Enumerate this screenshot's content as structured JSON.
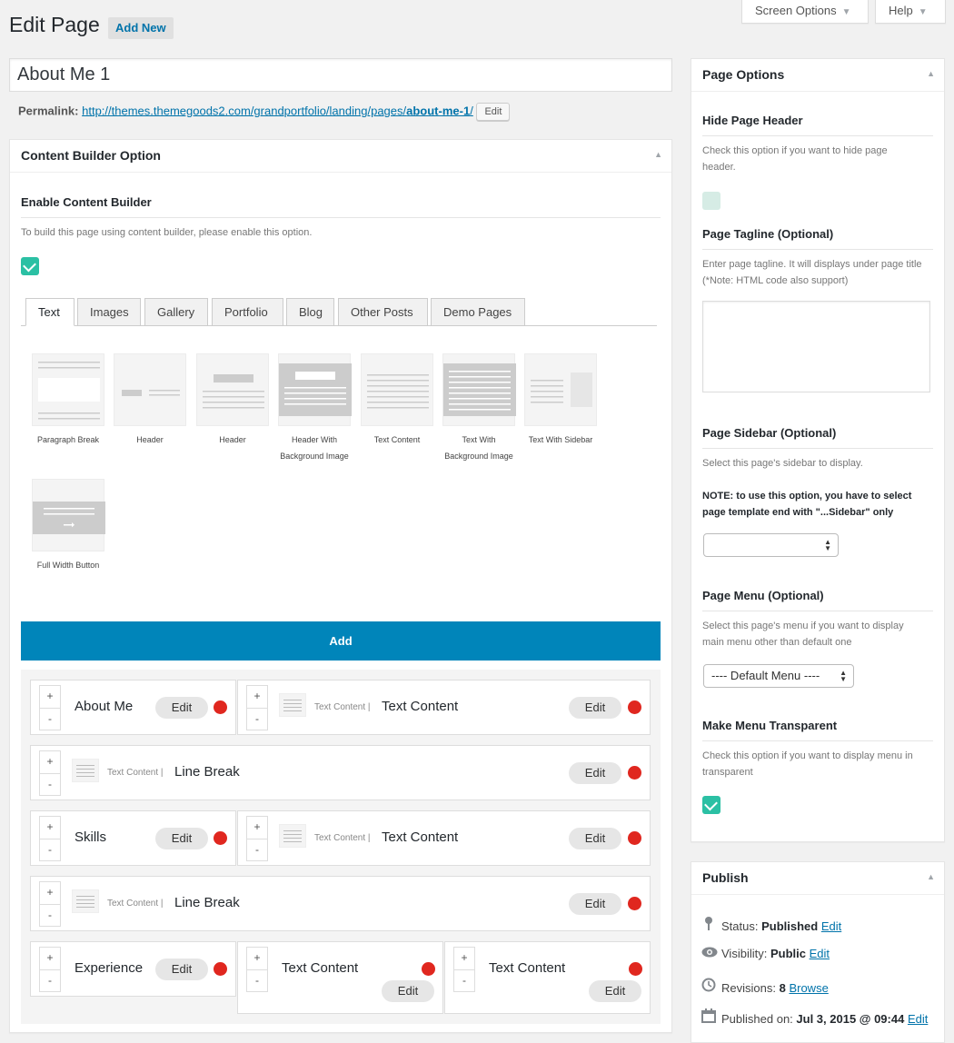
{
  "header": {
    "title": "Edit Page",
    "add_new": "Add New"
  },
  "screen_meta": {
    "screen_options": "Screen Options",
    "help": "Help"
  },
  "post": {
    "title": "About Me 1",
    "permalink_label": "Permalink:",
    "permalink_base": "http://themes.themegoods2.com/grandportfolio/landing/pages/",
    "permalink_slug": "about-me-1",
    "permalink_end": "/",
    "edit": "Edit"
  },
  "content_builder": {
    "box_title": "Content Builder Option",
    "enable_title": "Enable Content Builder",
    "enable_desc": "To build this page using content builder, please enable this option.",
    "tabs": [
      "Text",
      "Images",
      "Gallery",
      "Portfolio",
      "Blog",
      "Other Posts",
      "Demo Pages"
    ],
    "modules": [
      {
        "label1": "Paragraph Break",
        "label2": ""
      },
      {
        "label1": "Header",
        "label2": ""
      },
      {
        "label1": "Header",
        "label2": ""
      },
      {
        "label1": "Header With",
        "label2": "Background Image"
      },
      {
        "label1": "Text Content",
        "label2": ""
      },
      {
        "label1": "Text With",
        "label2": "Background Image"
      },
      {
        "label1": "Text With Sidebar",
        "label2": ""
      },
      {
        "label1": "Full Width Button",
        "label2": ""
      }
    ],
    "add_label": "Add",
    "edit_label": "Edit",
    "type_text": "Text Content |",
    "blocks": {
      "about_me": "About Me",
      "text_content": "Text Content",
      "line_break": "Line Break",
      "skills": "Skills",
      "experience": "Experience"
    },
    "stepper": {
      "plus": "+",
      "minus": "-"
    }
  },
  "page_options": {
    "box_title": "Page Options",
    "hide_header": {
      "title": "Hide Page Header",
      "desc1": "Check this option if you want to hide page",
      "desc2": "header."
    },
    "tagline": {
      "title": "Page Tagline (Optional)",
      "desc1": "Enter page tagline. It will displays under page title",
      "desc2": "(*Note: HTML code also support)"
    },
    "sidebar": {
      "title": "Page Sidebar (Optional)",
      "desc": "Select this page's sidebar to display.",
      "note1": "NOTE: to use this option, you have to select",
      "note2": "page template end with \"...Sidebar\" only",
      "value": ""
    },
    "menu": {
      "title": "Page Menu (Optional)",
      "desc1": "Select this page's menu if you want to display",
      "desc2": "main menu other than default one",
      "value": "---- Default Menu ----"
    },
    "transparent": {
      "title": "Make Menu Transparent",
      "desc1": "Check this option if you want to display menu in",
      "desc2": "transparent"
    }
  },
  "publish": {
    "box_title": "Publish",
    "status_label": "Status:",
    "status_value": "Published",
    "visibility_label": "Visibility:",
    "visibility_value": "Public",
    "revisions_label": "Revisions:",
    "revisions_value": "8",
    "browse": "Browse",
    "published_label": "Published on:",
    "published_value": "Jul 3, 2015 @ 09:44",
    "edit": "Edit"
  },
  "colors": {
    "accent": "#0085ba",
    "teal": "#2bc0a4",
    "red": "#e0271f"
  }
}
